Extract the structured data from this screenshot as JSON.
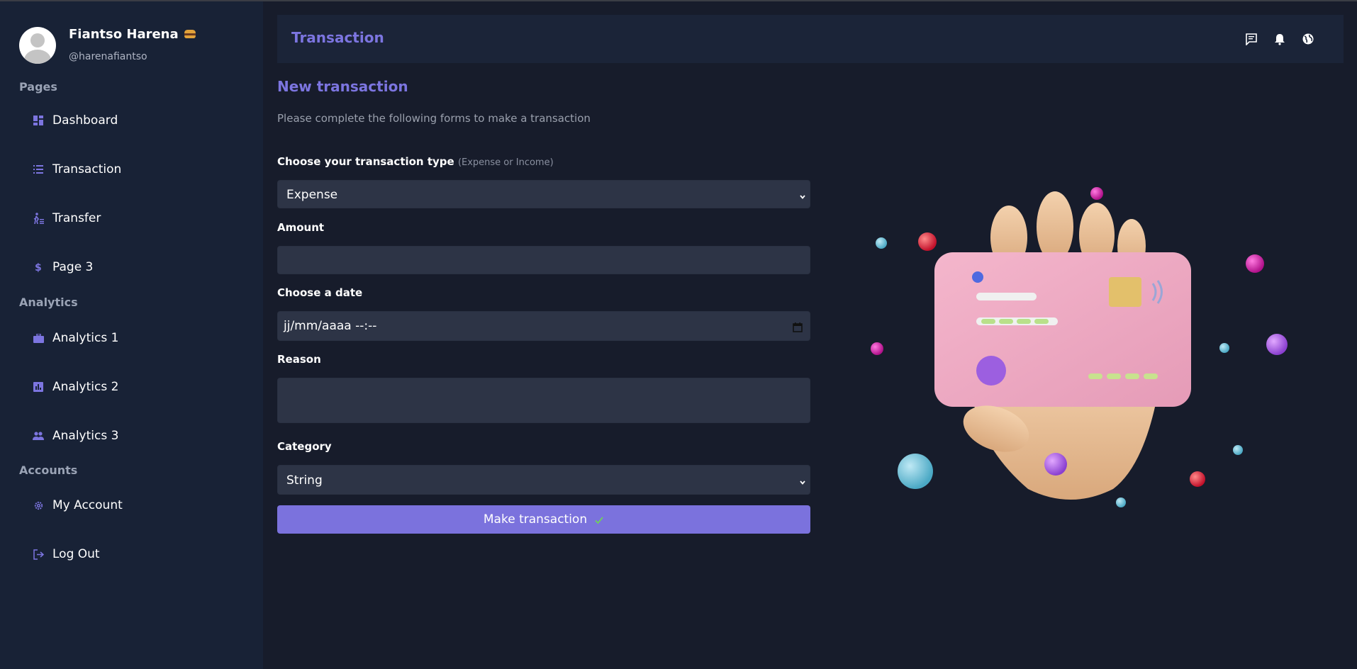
{
  "profile": {
    "name": "Fiantso Harena",
    "handle": "@harenafiantso"
  },
  "sidebar": {
    "sections": [
      {
        "title": "Pages"
      },
      {
        "title": "Analytics"
      },
      {
        "title": "Accounts"
      }
    ],
    "items": [
      {
        "label": "Dashboard",
        "icon": "dashboard-icon"
      },
      {
        "label": "Transaction",
        "icon": "list-icon"
      },
      {
        "label": "Transfer",
        "icon": "walking-icon"
      },
      {
        "label": "Page 3",
        "icon": "dollar-icon"
      },
      {
        "label": "Analytics 1",
        "icon": "briefcase-icon"
      },
      {
        "label": "Analytics 2",
        "icon": "bar-chart-icon"
      },
      {
        "label": "Analytics 3",
        "icon": "people-icon"
      },
      {
        "label": "My Account",
        "icon": "gear-icon"
      },
      {
        "label": "Log Out",
        "icon": "logout-icon"
      }
    ]
  },
  "header": {
    "title": "Transaction",
    "icons": [
      "chat-icon",
      "bell-icon",
      "globe-icon"
    ]
  },
  "form": {
    "title": "New transaction",
    "subtitle": "Please complete the following forms to make a transaction",
    "type_label": "Choose your transaction type",
    "type_hint": "(Expense or Income)",
    "type_value": "Expense",
    "amount_label": "Amount",
    "amount_value": "",
    "date_label": "Choose a date",
    "date_value": "jj/mm/aaaa --:--",
    "reason_label": "Reason",
    "reason_value": "",
    "category_label": "Category",
    "category_value": "String",
    "submit_label": "Make transaction"
  },
  "colors": {
    "accent": "#7b72dd",
    "sidebar_bg": "#182236",
    "page_bg": "#171c2b",
    "field_bg": "#2d3446",
    "check": "#6fcf5b"
  }
}
